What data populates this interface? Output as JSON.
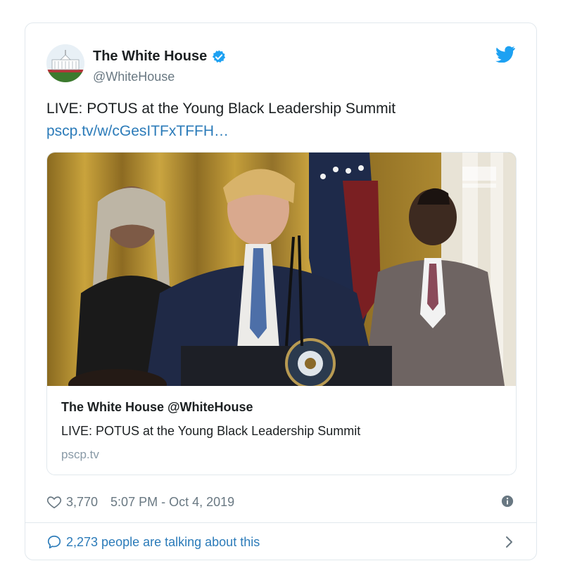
{
  "tweet": {
    "author_name": "The White House",
    "author_handle": "@WhiteHouse",
    "text": "LIVE: POTUS at the Young Black Leadership Summit",
    "link_text": "pscp.tv/w/cGesITFxTFFH…",
    "icons": {
      "verified": "verified-badge-icon",
      "brand": "twitter-bird-icon"
    }
  },
  "media_card": {
    "title": "The White House @WhiteHouse",
    "description": "LIVE: POTUS at the Young Black Leadership Summit",
    "domain": "pscp.tv",
    "image_alt": "Speaker at podium with presidential seal, flanked by two young people; flag and gold curtains behind"
  },
  "meta": {
    "likes": "3,770",
    "timestamp": "5:07 PM - Oct 4, 2019"
  },
  "footer": {
    "talking_label": "2,273 people are talking about this"
  },
  "colors": {
    "accent": "#1da1f2",
    "link": "#2b7bb9",
    "muted": "#697882",
    "border": "#e1e8ed"
  }
}
